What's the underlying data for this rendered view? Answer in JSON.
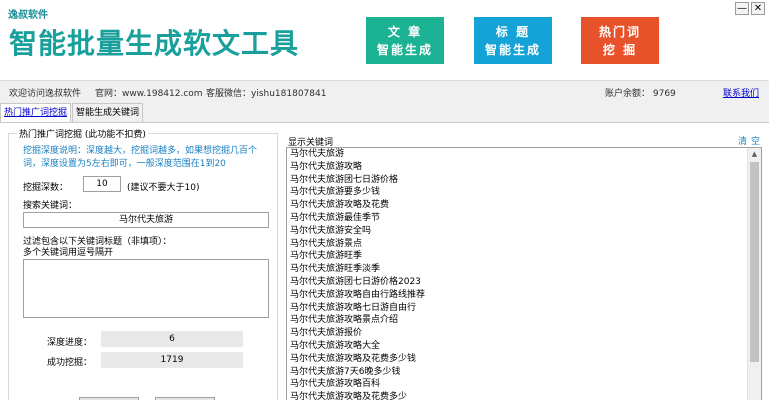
{
  "app": {
    "brand": "逸叔软件",
    "title": "智能批量生成软文工具",
    "window": {
      "minimize": "—",
      "close": "✕"
    }
  },
  "features": [
    {
      "line1": "文 章",
      "line2": "智能生成"
    },
    {
      "line1": "标 题",
      "line2": "智能生成"
    },
    {
      "line1": "热门词",
      "line2": "挖 掘"
    }
  ],
  "infobar": {
    "welcome": "欢迎访问逸叔软件",
    "website": "官网：www.198412.com",
    "wechat": "客服微信：yishu181807841",
    "balance": "账户余额：  9769",
    "contact": "联系我们"
  },
  "tabs": [
    {
      "label": "热门推广词挖掘"
    },
    {
      "label": "智能生成关键词"
    }
  ],
  "left": {
    "legend": "热门推广词挖掘 (此功能不扣费)",
    "description": "挖掘深度说明：深度越大，挖掘词越多，如果想挖掘几百个词，深度设置为5左右即可，一般深度范围在1到20",
    "depth_label": "挖掘深数：",
    "depth_value": "10",
    "depth_hint": "(建议不要大于10)",
    "search_label": "搜索关键词：",
    "search_value": "马尔代夫旅游",
    "filter_label": "过滤包含以下关键词标题（非填项）：",
    "filter_label2": "多个关键词用逗号隔开",
    "filter_value": "",
    "progress_label": "深度进度：",
    "progress_value": "6",
    "success_label": "成功挖掘：",
    "success_value": "1719"
  },
  "right": {
    "result_label": "显示关键词",
    "clear_label": "清空",
    "scroll_up": "▲",
    "keywords": [
      "马尔代夫旅游",
      "马尔代夫旅游攻略",
      "马尔代夫旅游团七日游价格",
      "马尔代夫旅游要多少钱",
      "马尔代夫旅游攻略及花费",
      "马尔代夫旅游最佳季节",
      "马尔代夫旅游安全吗",
      "马尔代夫旅游景点",
      "马尔代夫旅游旺季",
      "马尔代夫旅游旺季淡季",
      "马尔代夫旅游团七日游价格2023",
      "马尔代夫旅游攻略自由行路线推荐",
      "马尔代夫旅游攻略七日游自由行",
      "马尔代夫旅游攻略景点介绍",
      "马尔代夫旅游报价",
      "马尔代夫旅游攻略大全",
      "马尔代夫旅游攻略及花费多少钱",
      "马尔代夫旅游7天6晚多少钱",
      "马尔代夫旅游攻略百科",
      "马尔代夫旅游攻略及花费多少"
    ]
  }
}
